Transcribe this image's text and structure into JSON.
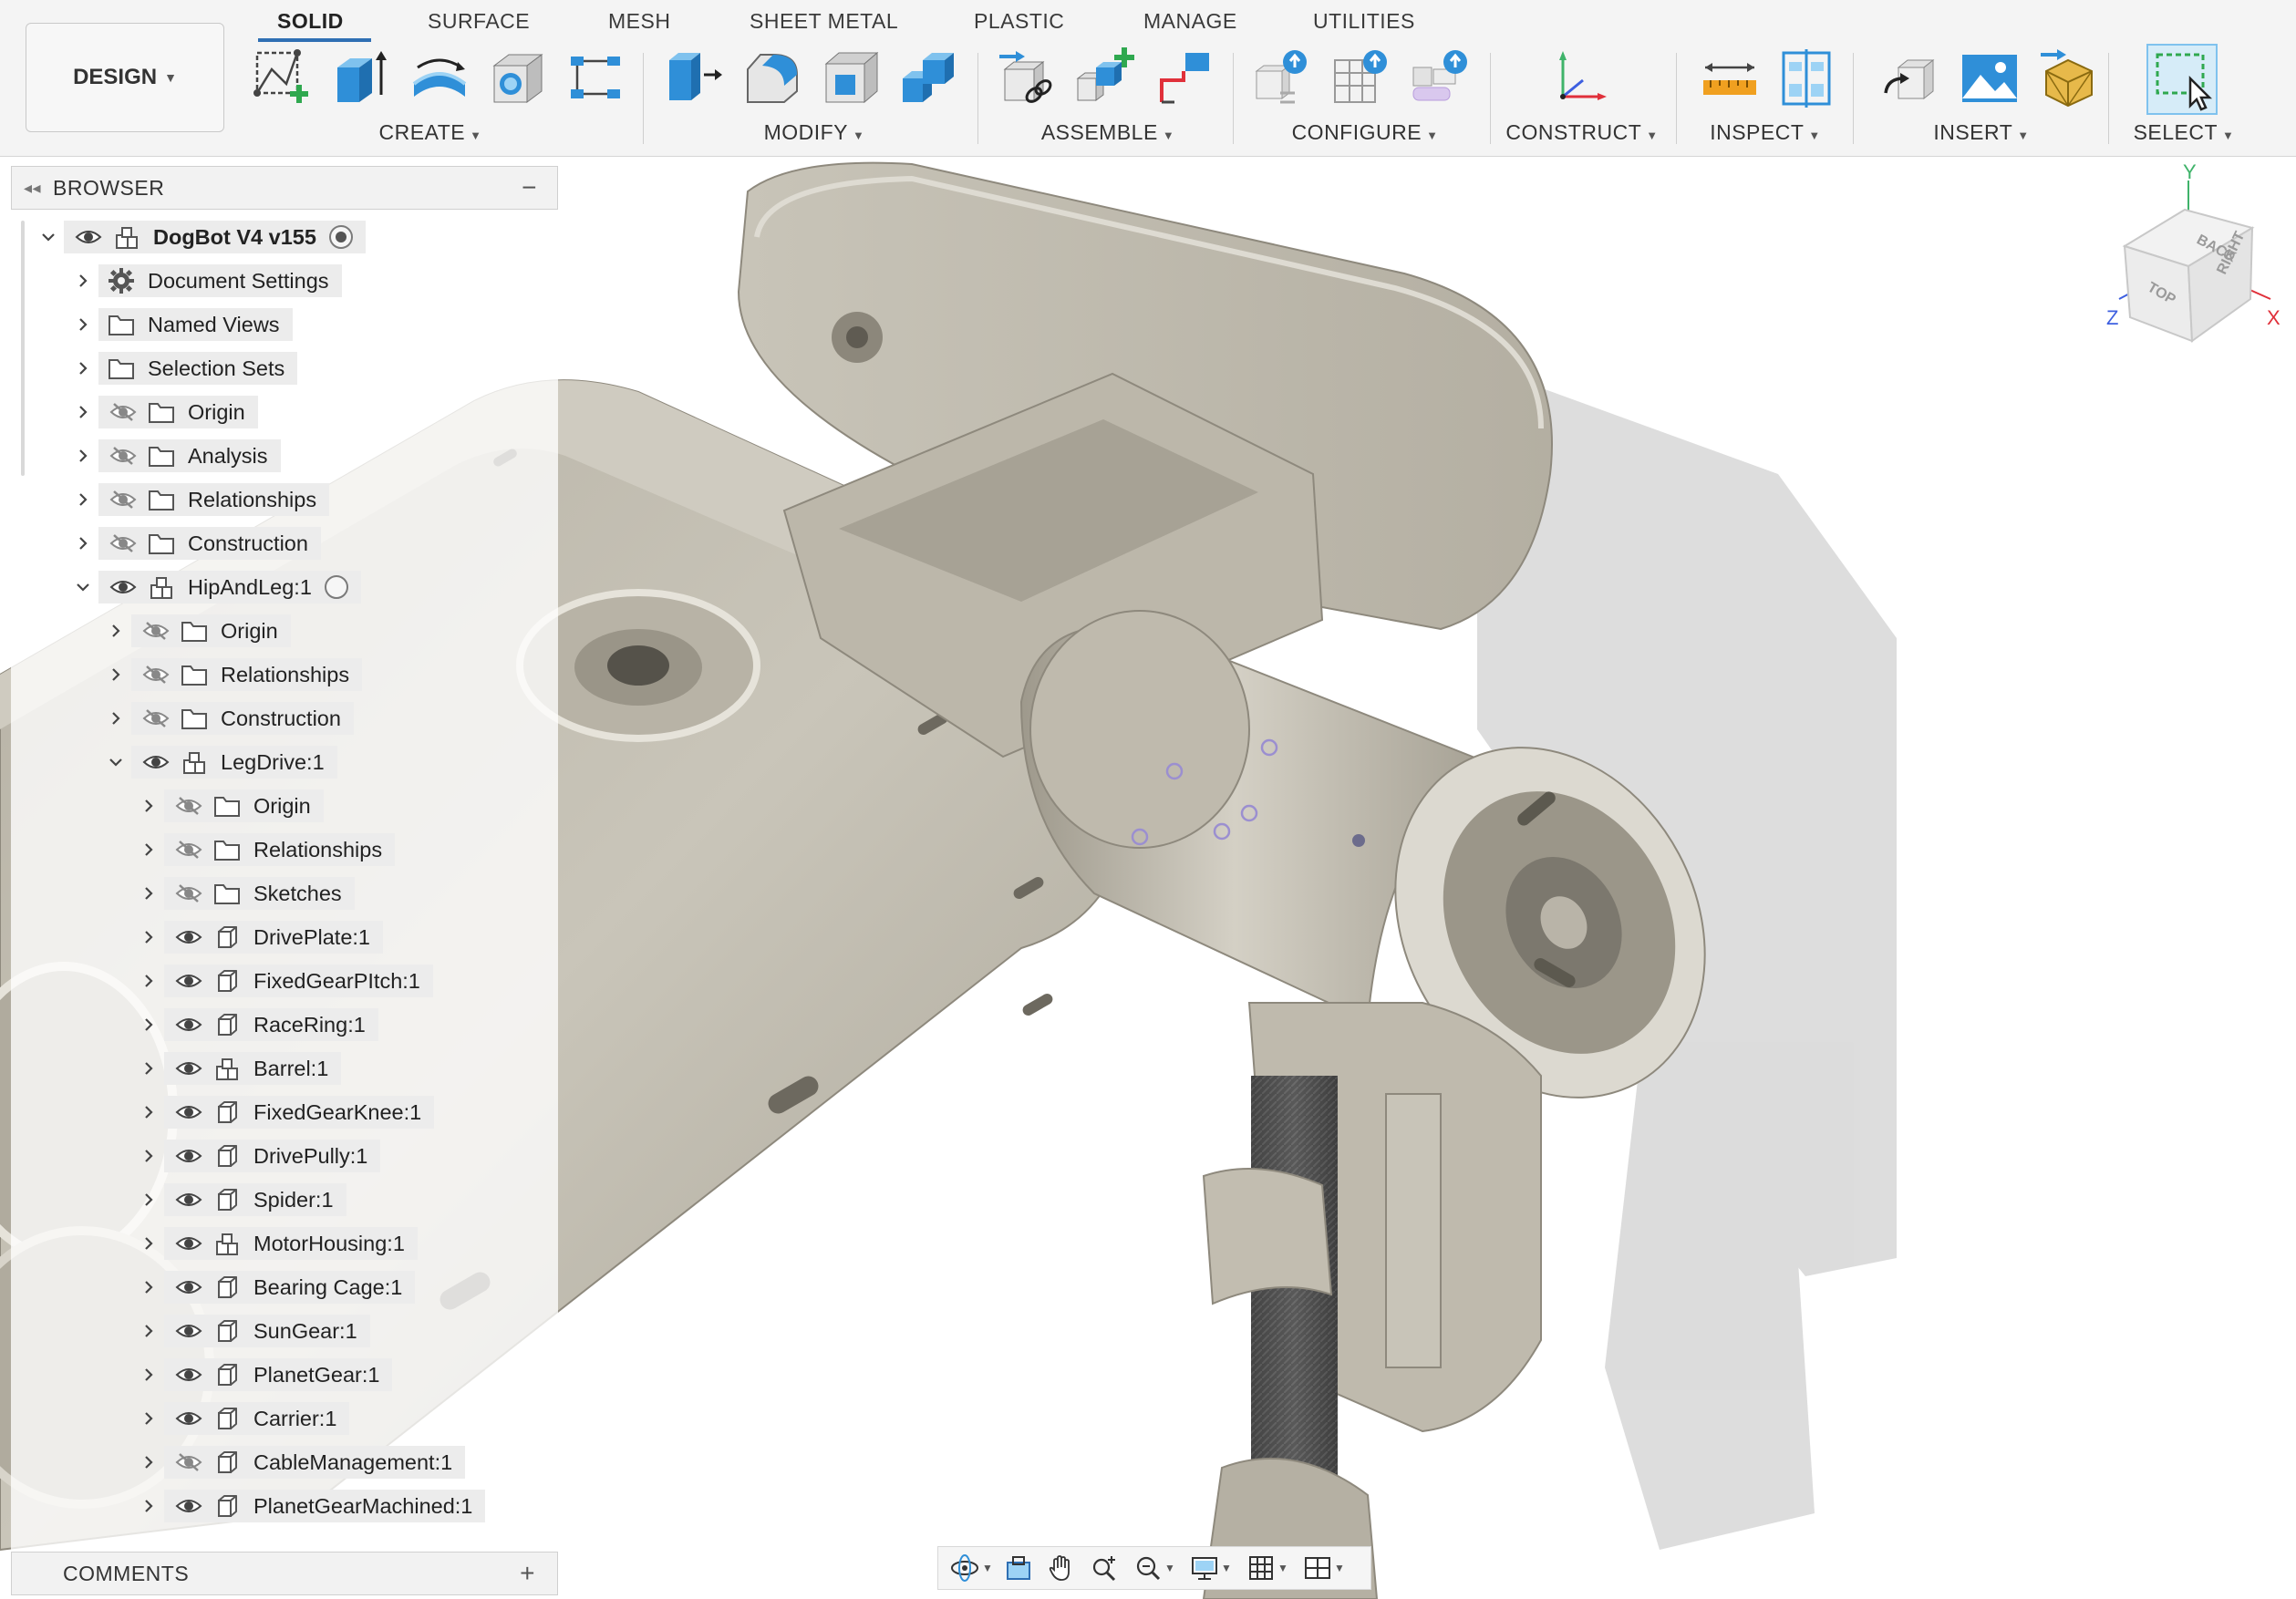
{
  "tabs": [
    "SOLID",
    "SURFACE",
    "MESH",
    "SHEET METAL",
    "PLASTIC",
    "MANAGE",
    "UTILITIES"
  ],
  "workspace": {
    "label": "DESIGN"
  },
  "groups": {
    "create": "CREATE",
    "modify": "MODIFY",
    "assemble": "ASSEMBLE",
    "configure": "CONFIGURE",
    "construct": "CONSTRUCT",
    "inspect": "INSPECT",
    "insert": "INSERT",
    "select": "SELECT"
  },
  "browser": {
    "title": "BROWSER",
    "items": [
      {
        "label": "DogBot V4 v155",
        "level": 0,
        "expanded": true,
        "eye": "visible",
        "icon": "component-icon",
        "bold": true,
        "radio": "active"
      },
      {
        "label": "Document Settings",
        "level": 1,
        "expanded": false,
        "eye": "none",
        "icon": "gear-icon"
      },
      {
        "label": "Named Views",
        "level": 1,
        "expanded": false,
        "eye": "none",
        "icon": "folder-icon"
      },
      {
        "label": "Selection Sets",
        "level": 1,
        "expanded": false,
        "eye": "none",
        "icon": "folder-icon"
      },
      {
        "label": "Origin",
        "level": 1,
        "expanded": false,
        "eye": "hidden",
        "icon": "folder-icon"
      },
      {
        "label": "Analysis",
        "level": 1,
        "expanded": false,
        "eye": "hidden",
        "icon": "folder-icon"
      },
      {
        "label": "Relationships",
        "level": 1,
        "expanded": false,
        "eye": "hidden",
        "icon": "folder-icon"
      },
      {
        "label": "Construction",
        "level": 1,
        "expanded": false,
        "eye": "hidden",
        "icon": "folder-icon"
      },
      {
        "label": "HipAndLeg:1",
        "level": 1,
        "expanded": true,
        "eye": "visible",
        "icon": "component-icon",
        "radio": "inactive"
      },
      {
        "label": "Origin",
        "level": 2,
        "expanded": false,
        "eye": "hidden",
        "icon": "folder-icon"
      },
      {
        "label": "Relationships",
        "level": 2,
        "expanded": false,
        "eye": "hidden",
        "icon": "folder-icon"
      },
      {
        "label": "Construction",
        "level": 2,
        "expanded": false,
        "eye": "hidden",
        "icon": "folder-icon"
      },
      {
        "label": "LegDrive:1",
        "level": 2,
        "expanded": true,
        "eye": "visible",
        "icon": "component-icon"
      },
      {
        "label": "Origin",
        "level": 3,
        "expanded": false,
        "eye": "hidden",
        "icon": "folder-icon"
      },
      {
        "label": "Relationships",
        "level": 3,
        "expanded": false,
        "eye": "hidden",
        "icon": "folder-icon"
      },
      {
        "label": "Sketches",
        "level": 3,
        "expanded": false,
        "eye": "hidden",
        "icon": "folder-icon"
      },
      {
        "label": "DrivePlate:1",
        "level": 3,
        "expanded": false,
        "eye": "visible",
        "icon": "body-icon"
      },
      {
        "label": "FixedGearPItch:1",
        "level": 3,
        "expanded": false,
        "eye": "visible",
        "icon": "body-icon"
      },
      {
        "label": "RaceRing:1",
        "level": 3,
        "expanded": false,
        "eye": "visible",
        "icon": "body-icon"
      },
      {
        "label": "Barrel:1",
        "level": 3,
        "expanded": false,
        "eye": "visible",
        "icon": "component-icon"
      },
      {
        "label": "FixedGearKnee:1",
        "level": 3,
        "expanded": false,
        "eye": "visible",
        "icon": "body-icon"
      },
      {
        "label": "DrivePully:1",
        "level": 3,
        "expanded": false,
        "eye": "visible",
        "icon": "body-icon"
      },
      {
        "label": "Spider:1",
        "level": 3,
        "expanded": false,
        "eye": "visible",
        "icon": "body-icon"
      },
      {
        "label": "MotorHousing:1",
        "level": 3,
        "expanded": false,
        "eye": "visible",
        "icon": "component-icon"
      },
      {
        "label": "Bearing Cage:1",
        "level": 3,
        "expanded": false,
        "eye": "visible",
        "icon": "body-icon"
      },
      {
        "label": "SunGear:1",
        "level": 3,
        "expanded": false,
        "eye": "visible",
        "icon": "body-icon"
      },
      {
        "label": "PlanetGear:1",
        "level": 3,
        "expanded": false,
        "eye": "visible",
        "icon": "body-icon"
      },
      {
        "label": "Carrier:1",
        "level": 3,
        "expanded": false,
        "eye": "visible",
        "icon": "body-icon"
      },
      {
        "label": "CableManagement:1",
        "level": 3,
        "expanded": false,
        "eye": "hidden",
        "icon": "body-icon"
      },
      {
        "label": "PlanetGearMachined:1",
        "level": 3,
        "expanded": false,
        "eye": "visible",
        "icon": "body-icon"
      }
    ]
  },
  "comments": {
    "title": "COMMENTS"
  },
  "viewcube": {
    "faces": [
      "TOP",
      "BACK",
      "RIGHT"
    ],
    "axes": [
      "X",
      "Y",
      "Z"
    ]
  },
  "colors": {
    "accent": "#2f6fb3",
    "model": "#bdb8ac",
    "axis_x": "#e0303a",
    "axis_y": "#3fb36a",
    "axis_z": "#3d5fe0"
  }
}
